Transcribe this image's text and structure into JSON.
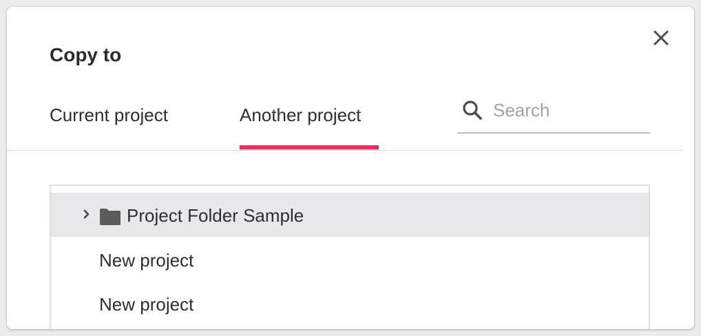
{
  "dialog": {
    "title": "Copy to",
    "close_icon": "close-icon"
  },
  "tabs": [
    {
      "label": "Current project",
      "active": false
    },
    {
      "label": "Another project",
      "active": true
    }
  ],
  "search": {
    "placeholder": "Search",
    "value": "",
    "icon": "search-icon"
  },
  "tree": {
    "items": [
      {
        "label": "Project Folder Sample",
        "type": "folder",
        "selected": true,
        "collapsed": true
      },
      {
        "label": "New project",
        "type": "project",
        "selected": false
      },
      {
        "label": "New project",
        "type": "project",
        "selected": false
      }
    ]
  },
  "colors": {
    "accent": "#f5285b",
    "selected_row": "#e5e9ea",
    "text": "#2e2e2e",
    "placeholder": "#a3a3a3"
  }
}
